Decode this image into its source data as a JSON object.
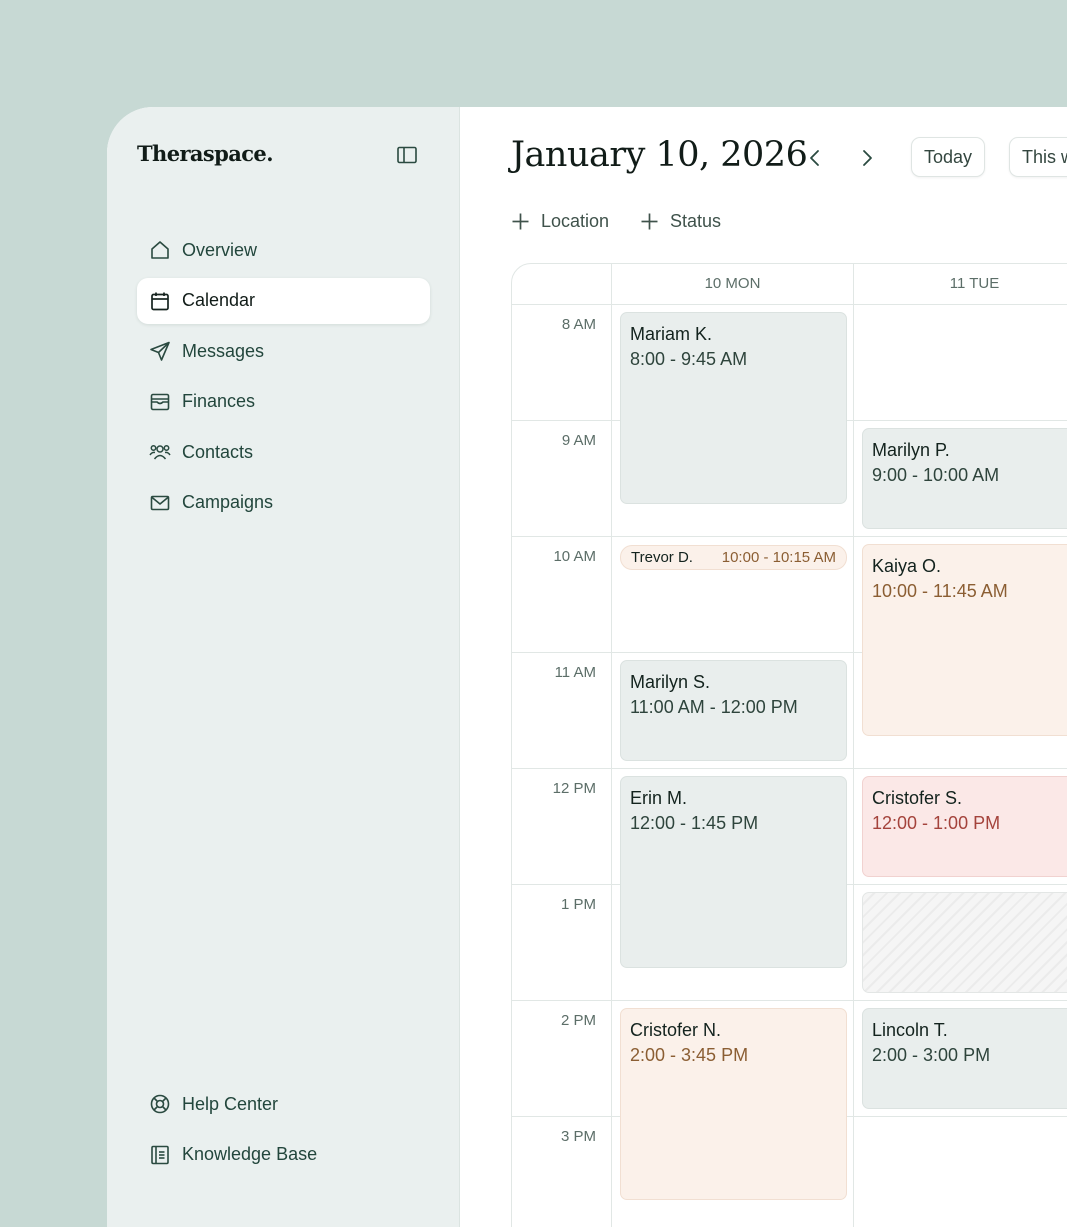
{
  "sidebar": {
    "logo": "Theraspace.",
    "items": [
      {
        "label": "Overview"
      },
      {
        "label": "Calendar"
      },
      {
        "label": "Messages"
      },
      {
        "label": "Finances"
      },
      {
        "label": "Contacts"
      },
      {
        "label": "Campaigns"
      }
    ],
    "footer_items": [
      {
        "label": "Help Center"
      },
      {
        "label": "Knowledge Base"
      }
    ]
  },
  "header": {
    "date": "January 10, 2026",
    "today_label": "Today",
    "view_label": "This week"
  },
  "filters": {
    "location_label": "Location",
    "status_label": "Status"
  },
  "calendar": {
    "days": [
      "10 MON",
      "11 TUE"
    ],
    "times": [
      "8 AM",
      "9 AM",
      "10 AM",
      "11 AM",
      "12 PM",
      "1 PM",
      "2 PM",
      "3 PM"
    ],
    "events": [
      {
        "name": "Mariam K.",
        "time": "8:00 - 9:45 AM"
      },
      {
        "name": "Trevor D.",
        "time": "10:00 - 10:15 AM"
      },
      {
        "name": "Marilyn S.",
        "time": "11:00 AM - 12:00 PM"
      },
      {
        "name": "Erin M.",
        "time": "12:00 - 1:45 PM"
      },
      {
        "name": "Cristofer N.",
        "time": "2:00 - 3:45 PM"
      },
      {
        "name": "Marilyn P.",
        "time": "9:00 - 10:00 AM"
      },
      {
        "name": "Kaiya O.",
        "time": "10:00 - 11:45 AM"
      },
      {
        "name": "Cristofer S.",
        "time": "12:00 - 1:00 PM"
      },
      {
        "name": "Lincoln T.",
        "time": "2:00 - 3:00 PM"
      }
    ]
  },
  "colors": {
    "background": "#c7d9d4",
    "sidebar": "#eaf0ef",
    "event_gray": "#e9eeed",
    "event_peach": "#fbf1ea",
    "event_pink": "#fbe8e7"
  }
}
